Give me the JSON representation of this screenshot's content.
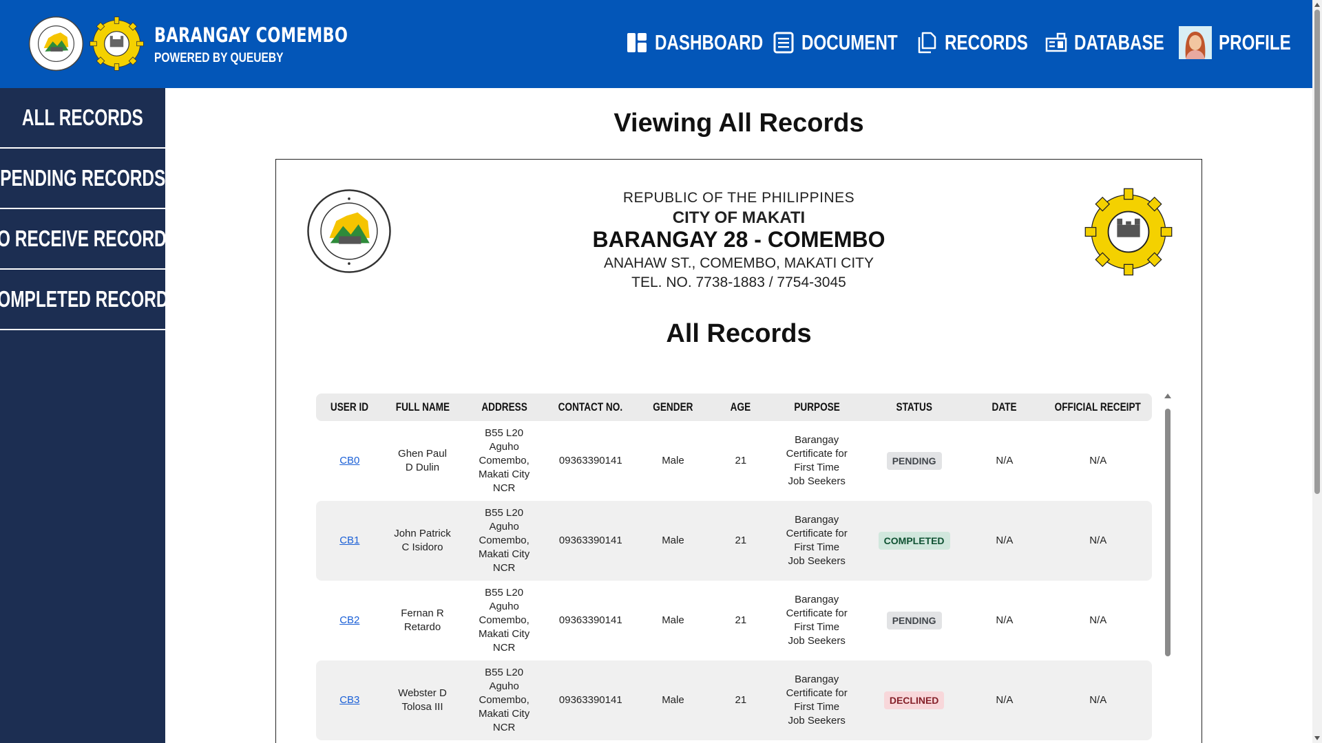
{
  "brand": {
    "title": "BARANGAY COMEMBO",
    "subtitle": "POWERED BY QUEUEBY",
    "logo_left_icon": "makati-seal-logo",
    "logo_right_icon": "comembo-seal-logo"
  },
  "nav": {
    "dashboard": "DASHBOARD",
    "document": "DOCUMENT",
    "records": "RECORDS",
    "database": "DATABASE",
    "profile": "PROFILE"
  },
  "sidebar": {
    "items": [
      {
        "label": "ALL RECORDS"
      },
      {
        "label": "PENDING RECORDS"
      },
      {
        "label": "TO RECEIVE RECORDS"
      },
      {
        "label": "COMPLETED RECORDS"
      }
    ]
  },
  "main": {
    "page_title": "Viewing All Records"
  },
  "letterhead": {
    "republic": "REPUBLIC OF THE PHILIPPINES",
    "city": "CITY OF MAKATI",
    "barangay": "BARANGAY 28 - COMEMBO",
    "address": "ANAHAW ST., COMEMBO, MAKATI CITY",
    "tel": "TEL. NO. 7738-1883 / 7754-3045",
    "heading": "All Records"
  },
  "table": {
    "headers": [
      "USER ID",
      "FULL NAME",
      "ADDRESS",
      "CONTACT NO.",
      "GENDER",
      "AGE",
      "PURPOSE",
      "STATUS",
      "DATE",
      "OFFICIAL RECEIPT"
    ],
    "rows": [
      {
        "user_id": "CB0",
        "name_1": "Ghen Paul",
        "name_2": "D Dulin",
        "addr_1": "B55 L20",
        "addr_2": "Aguho",
        "addr_3": "Comembo,",
        "addr_4": "Makati City",
        "addr_5": "NCR",
        "contact": "09363390141",
        "gender": "Male",
        "age": "21",
        "purpose_1": "Barangay",
        "purpose_2": "Certificate for",
        "purpose_3": "First Time",
        "purpose_4": "Job Seekers",
        "status": "PENDING",
        "date": "N/A",
        "receipt": "N/A"
      },
      {
        "user_id": "CB1",
        "name_1": "John Patrick",
        "name_2": "C Isidoro",
        "addr_1": "B55 L20",
        "addr_2": "Aguho",
        "addr_3": "Comembo,",
        "addr_4": "Makati City",
        "addr_5": "NCR",
        "contact": "09363390141",
        "gender": "Male",
        "age": "21",
        "purpose_1": "Barangay",
        "purpose_2": "Certificate for",
        "purpose_3": "First Time",
        "purpose_4": "Job Seekers",
        "status": "COMPLETED",
        "date": "N/A",
        "receipt": "N/A"
      },
      {
        "user_id": "CB2",
        "name_1": "Fernan R",
        "name_2": "Retardo",
        "addr_1": "B55 L20",
        "addr_2": "Aguho",
        "addr_3": "Comembo,",
        "addr_4": "Makati City",
        "addr_5": "NCR",
        "contact": "09363390141",
        "gender": "Male",
        "age": "21",
        "purpose_1": "Barangay",
        "purpose_2": "Certificate for",
        "purpose_3": "First Time",
        "purpose_4": "Job Seekers",
        "status": "PENDING",
        "date": "N/A",
        "receipt": "N/A"
      },
      {
        "user_id": "CB3",
        "name_1": "Webster D",
        "name_2": "Tolosa III",
        "addr_1": "B55 L20",
        "addr_2": "Aguho",
        "addr_3": "Comembo,",
        "addr_4": "Makati City",
        "addr_5": "NCR",
        "contact": "09363390141",
        "gender": "Male",
        "age": "21",
        "purpose_1": "Barangay",
        "purpose_2": "Certificate for",
        "purpose_3": "First Time",
        "purpose_4": "Job Seekers",
        "status": "DECLINED",
        "date": "N/A",
        "receipt": "N/A"
      }
    ]
  },
  "status_colors": {
    "PENDING": {
      "bg": "#e2e3e5",
      "fg": "#41464b"
    },
    "COMPLETED": {
      "bg": "#d1e7dd",
      "fg": "#0f5132"
    },
    "DECLINED": {
      "bg": "#f8d7da",
      "fg": "#842029"
    }
  },
  "colors": {
    "topbar": "#0356b8",
    "sidebar": "#1c2e52",
    "link": "#1a5fd6"
  }
}
